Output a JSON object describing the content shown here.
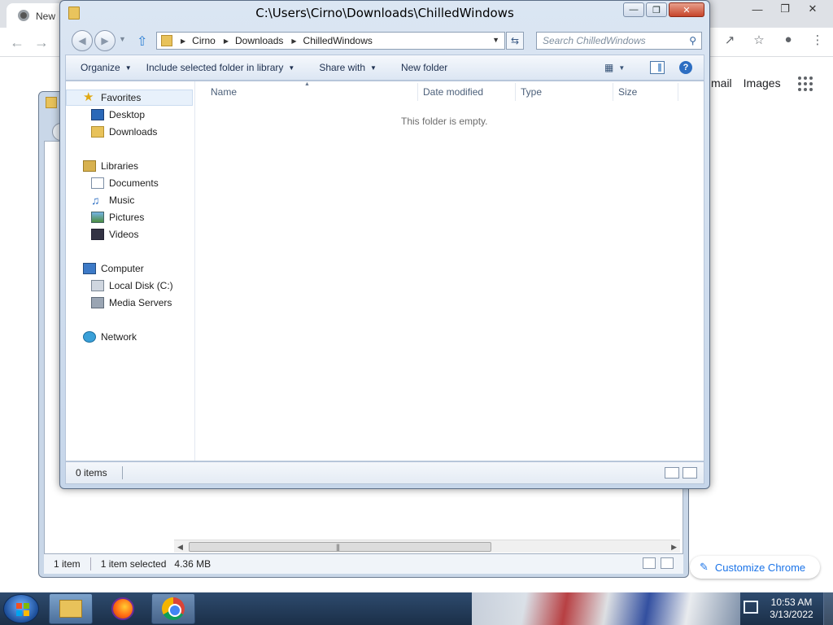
{
  "chrome": {
    "tab_title": "New",
    "links": [
      "mail",
      "Images"
    ],
    "customize_label": "Customize Chrome",
    "win_buttons": [
      "—",
      "❐",
      "✕"
    ]
  },
  "back_window": {
    "status_items": "1 item",
    "status_selected": "1 item selected",
    "status_size": "4.36 MB"
  },
  "explorer": {
    "title": "C:\\Users\\Cirno\\Downloads\\ChilledWindows",
    "controls": {
      "minimize": "—",
      "maximize": "❐",
      "close": "✕"
    },
    "breadcrumb": [
      "Cirno",
      "Downloads",
      "ChilledWindows"
    ],
    "search_placeholder": "Search ChilledWindows",
    "toolbar": {
      "organize": "Organize",
      "include_library": "Include selected folder in library",
      "share_with": "Share with",
      "new_folder": "New folder",
      "help": "?"
    },
    "nav": {
      "favorites": "Favorites",
      "desktop": "Desktop",
      "downloads": "Downloads",
      "libraries": "Libraries",
      "documents": "Documents",
      "music": "Music",
      "pictures": "Pictures",
      "videos": "Videos",
      "computer": "Computer",
      "local_disk": "Local Disk (C:)",
      "media_servers": "Media Servers",
      "network": "Network"
    },
    "columns": [
      "Name",
      "Date modified",
      "Type",
      "Size"
    ],
    "empty_message": "This folder is empty.",
    "status": "0 items"
  },
  "taskbar": {
    "time": "10:53 AM",
    "date": "3/13/2022"
  },
  "colors": {
    "chrome_accent": "#1a73e8",
    "win7_frame": "#c6d6ea",
    "taskbar": "#1b2f48"
  }
}
